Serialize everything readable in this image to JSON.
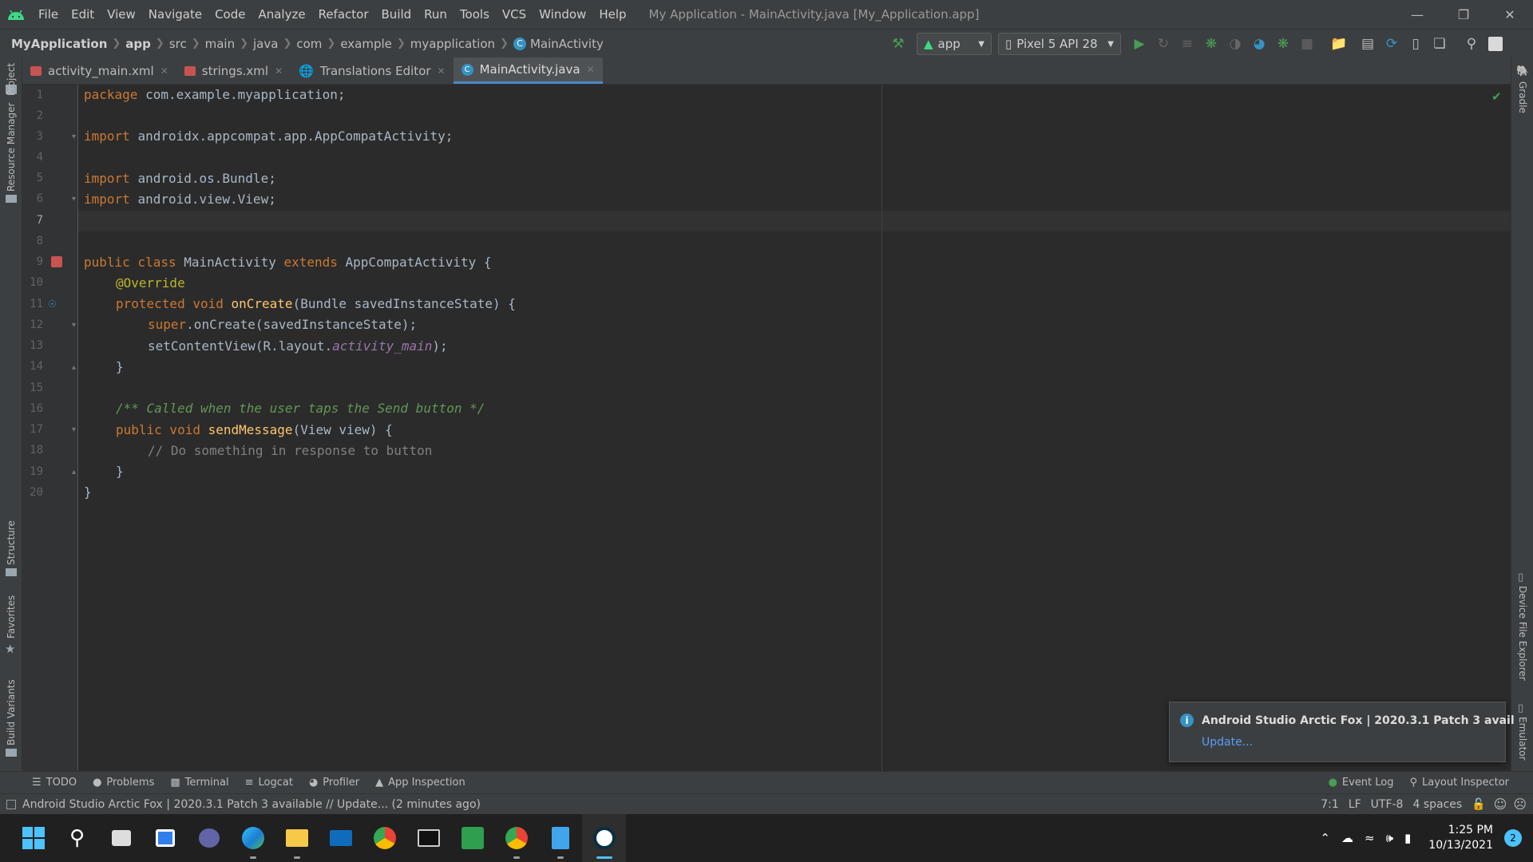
{
  "colors": {
    "accent": "#4a88c7",
    "android_green": "#3ddc84",
    "run_green": "#499c54",
    "info_blue": "#3592c4"
  },
  "titlebar": {
    "menu": [
      "File",
      "Edit",
      "View",
      "Navigate",
      "Code",
      "Analyze",
      "Refactor",
      "Build",
      "Run",
      "Tools",
      "VCS",
      "Window",
      "Help"
    ],
    "title": "My Application - MainActivity.java [My_Application.app]"
  },
  "navbar": {
    "crumbs": [
      "MyApplication",
      "app",
      "src",
      "main",
      "java",
      "com",
      "example",
      "myapplication",
      "MainActivity"
    ],
    "run_config": "app",
    "device": "Pixel 5 API 28"
  },
  "tabs": [
    {
      "label": "activity_main.xml",
      "icon": "xml-layout-icon"
    },
    {
      "label": "strings.xml",
      "icon": "xml-values-icon"
    },
    {
      "label": "Translations Editor",
      "icon": "globe-icon"
    },
    {
      "label": "MainActivity.java",
      "icon": "class-icon",
      "active": true
    }
  ],
  "left_tools": [
    "Project",
    "Resource Manager",
    "Structure",
    "Favorites",
    "Build Variants"
  ],
  "right_tools": [
    "Gradle",
    "Device File Explorer",
    "Emulator"
  ],
  "editor": {
    "line_numbers": [
      "1",
      "2",
      "3",
      "4",
      "5",
      "6",
      "7",
      "8",
      "9",
      "10",
      "11",
      "12",
      "13",
      "14",
      "15",
      "16",
      "17",
      "18",
      "19",
      "20"
    ],
    "lines": {
      "l1a": "package ",
      "l1b": "com.example.myapplication;",
      "l3a": "import ",
      "l3b": "androidx.appcompat.app.AppCompatActivity;",
      "l5a": "import ",
      "l5b": "android.os.Bundle;",
      "l6a": "import ",
      "l6b": "android.view.View;",
      "l9a": "public class ",
      "l9b": "MainActivity ",
      "l9c": "extends ",
      "l9d": "AppCompatActivity {",
      "l10": "@Override",
      "l11a": "protected void ",
      "l11b": "onCreate",
      "l11c": "(Bundle savedInstanceState) {",
      "l12a": "super",
      ".": "",
      "l12b": ".onCreate(savedInstanceState);",
      "l13a": "setContentView(R.layout.",
      "l13b": "activity_main",
      "l13c": ");",
      "l14": "}",
      "l16": "/** Called when the user taps the Send button */",
      "l17a": "public void ",
      "l17b": "sendMessage",
      "l17c": "(View view) {",
      "l18": "// Do something in response to button",
      "l19": "}",
      "l20": "}"
    }
  },
  "notification": {
    "title": "Android Studio Arctic Fox | 2020.3.1 Patch 3 avail",
    "link": "Update..."
  },
  "toolwindows": {
    "left": [
      "TODO",
      "Problems",
      "Terminal",
      "Logcat",
      "Profiler",
      "App Inspection"
    ],
    "right": [
      "Event Log",
      "Layout Inspector"
    ]
  },
  "status": {
    "message": "Android Studio Arctic Fox | 2020.3.1 Patch 3 available // Update... (2 minutes ago)",
    "position": "7:1",
    "line_sep": "LF",
    "encoding": "UTF-8",
    "indent": "4 spaces"
  },
  "taskbar": {
    "time": "1:25 PM",
    "date": "10/13/2021",
    "notif_count": "2"
  }
}
